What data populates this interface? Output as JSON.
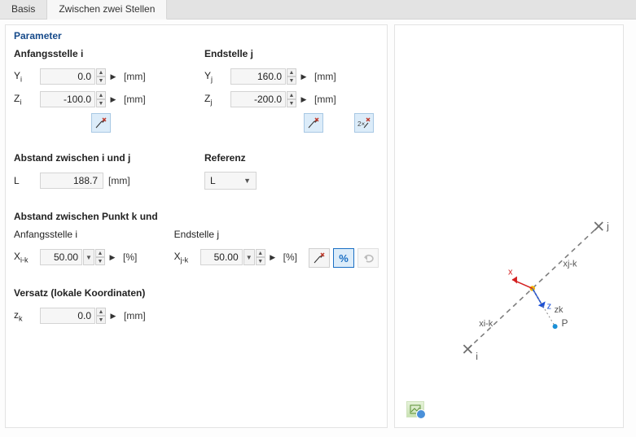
{
  "tabs": {
    "basis": "Basis",
    "between": "Zwischen zwei Stellen"
  },
  "panel": {
    "title": "Parameter",
    "startI": "Anfangsstelle i",
    "endJ": "Endstelle j",
    "yi": "0.0",
    "zi": "-100.0",
    "yj": "160.0",
    "zj": "-200.0",
    "mm": "[mm]",
    "distIJ": "Abstand zwischen i und j",
    "reference": "Referenz",
    "L_label": "L",
    "L_value": "188.7",
    "ref_value": "L",
    "distK": "Abstand zwischen Punkt k und",
    "xik": "50.00",
    "xjk": "50.00",
    "pct": "[%]",
    "offset": "Versatz (lokale Koordinaten)",
    "zk": "0.0",
    "percent_btn": "%"
  },
  "labels": {
    "Yi_pre": "Y",
    "Yi_sub": "i",
    "Zi_pre": "Z",
    "Zi_sub": "i",
    "Yj_pre": "Y",
    "Yj_sub": "j",
    "Zj_pre": "Z",
    "Zj_sub": "j",
    "Xik_pre": "X",
    "Xik_sub": "i-k",
    "Xjk_pre": "X",
    "Xjk_sub": "j-k",
    "Zk_pre": "z",
    "Zk_sub": "k"
  },
  "diagram": {
    "i": "i",
    "j": "j",
    "x": "x",
    "z": "z",
    "zk": "zk",
    "xik": "xi-k",
    "xjk": "xj-k",
    "P": "P"
  }
}
